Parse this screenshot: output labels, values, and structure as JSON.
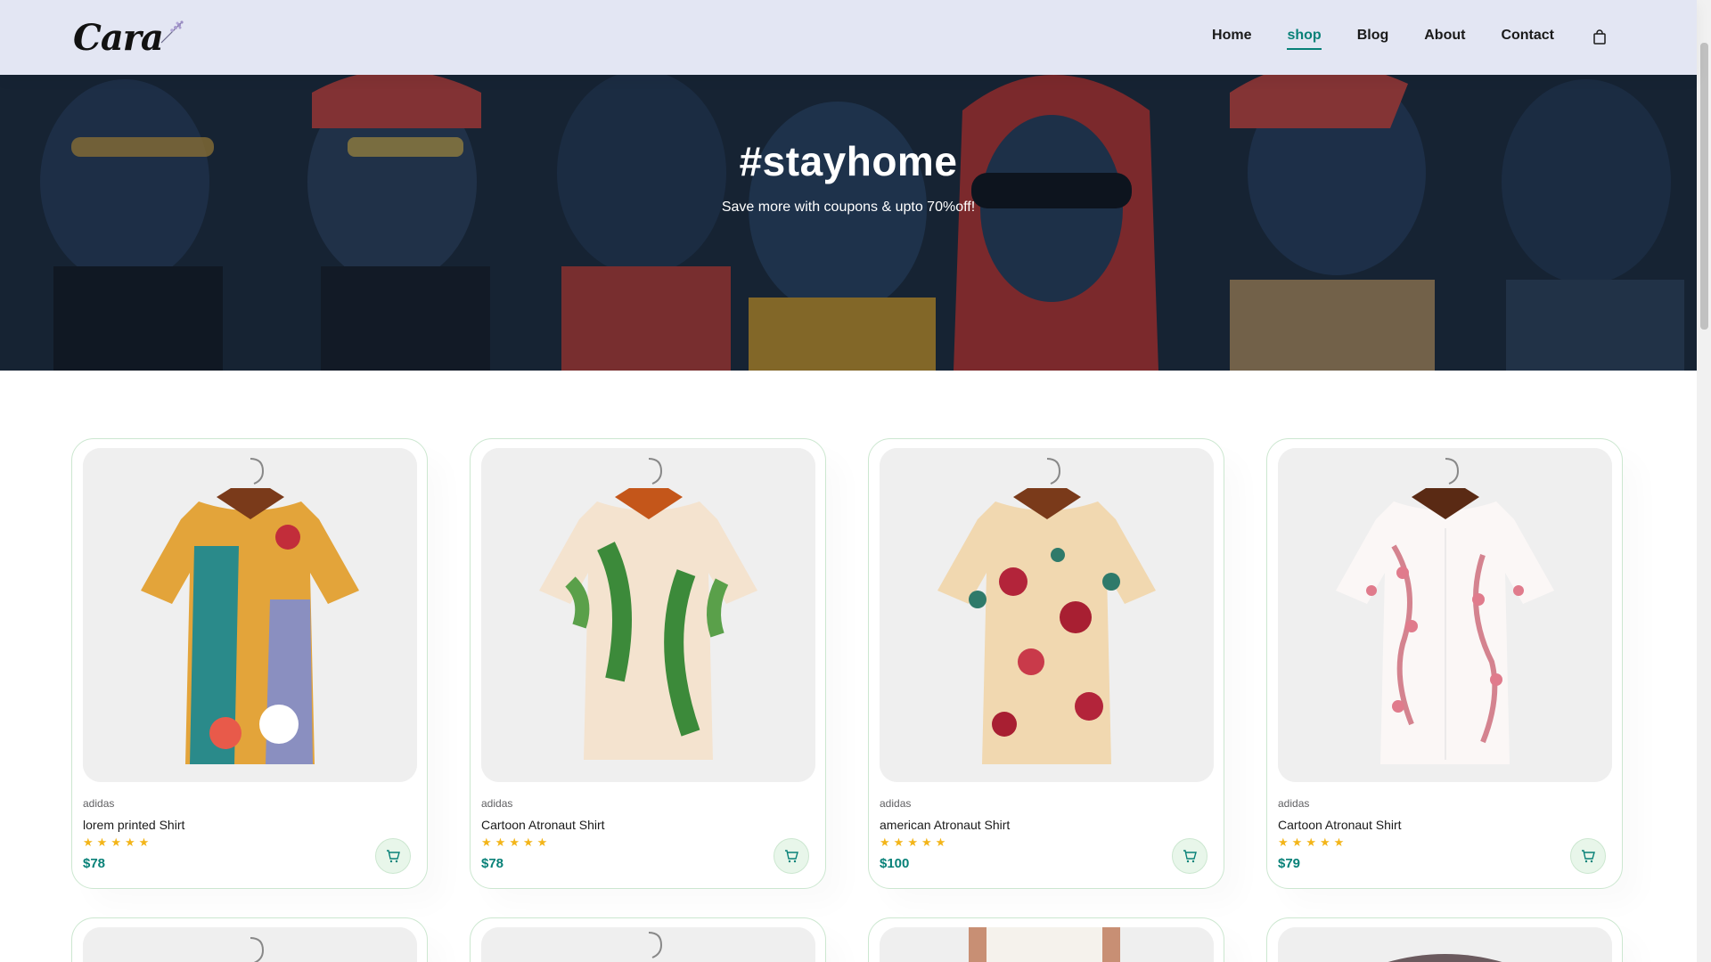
{
  "header": {
    "logo_text": "Cara",
    "nav": [
      {
        "label": "Home",
        "active": false
      },
      {
        "label": "shop",
        "active": true
      },
      {
        "label": "Blog",
        "active": false
      },
      {
        "label": "About",
        "active": false
      },
      {
        "label": "Contact",
        "active": false
      }
    ],
    "cart_icon": "shopping-bag-icon"
  },
  "hero": {
    "title": "#stayhome",
    "subtitle": "Save more with coupons & upto 70%off!"
  },
  "products": [
    {
      "brand": "adidas",
      "name": "lorem printed Shirt",
      "rating": 5,
      "price": "$78"
    },
    {
      "brand": "adidas",
      "name": "Cartoon Atronaut Shirt",
      "rating": 5,
      "price": "$78"
    },
    {
      "brand": "adidas",
      "name": "american Atronaut Shirt",
      "rating": 5,
      "price": "$100"
    },
    {
      "brand": "adidas",
      "name": "Cartoon Atronaut Shirt",
      "rating": 5,
      "price": "$79"
    }
  ],
  "colors": {
    "accent": "#088178",
    "header_bg": "#e3e6f3",
    "star": "#f3b519",
    "card_border": "#cce7d0"
  }
}
